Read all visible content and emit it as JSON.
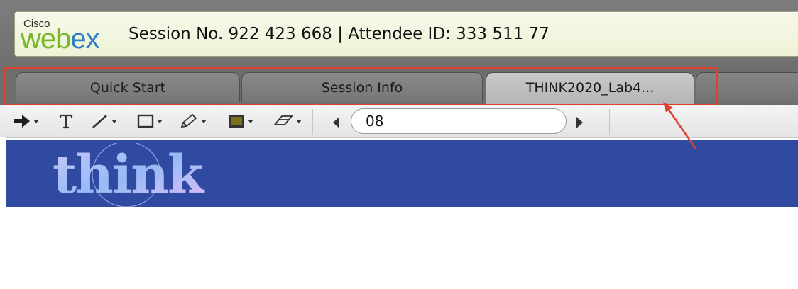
{
  "header": {
    "logo_top": "Cisco",
    "logo_main_a": "web",
    "logo_main_b": "ex",
    "session_text": "Session No. 922 423 668 | Attendee ID: 333 511 77"
  },
  "tabs": [
    {
      "label": "Quick Start",
      "active": false
    },
    {
      "label": "Session Info",
      "active": false
    },
    {
      "label": "THINK2020_Lab4...",
      "active": true
    }
  ],
  "toolbar": {
    "tools": [
      "pointer-tool",
      "text-tool",
      "line-tool",
      "rectangle-tool",
      "highlighter-tool",
      "color-tool",
      "eraser-tool"
    ],
    "page_value": "08",
    "fill_color": "#7a7020"
  },
  "slide": {
    "banner_color": "#2f4aa0",
    "logo_text": "think"
  },
  "annotation": {
    "color": "#e0412f"
  }
}
